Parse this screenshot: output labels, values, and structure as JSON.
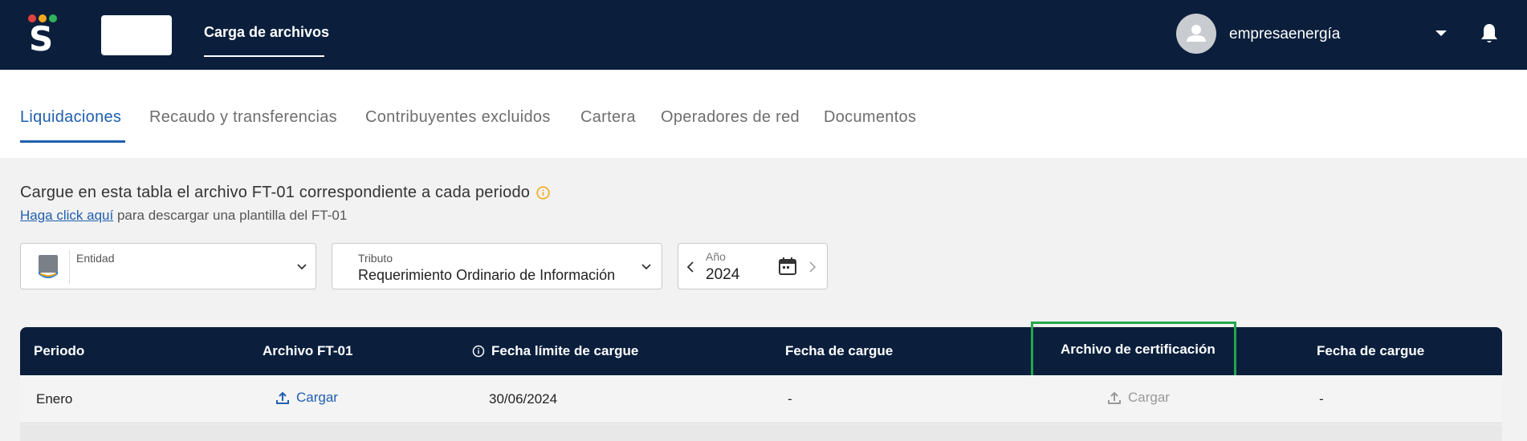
{
  "header": {
    "nav_link": "Carga de archivos",
    "username": "empresaenergía",
    "logo_colors": [
      "#e0413e",
      "#f2a91e",
      "#2fb35a"
    ]
  },
  "tabs": [
    {
      "label": "Liquidaciones",
      "active": true
    },
    {
      "label": "Recaudo y transferencias",
      "active": false
    },
    {
      "label": "Contribuyentes excluidos",
      "active": false
    },
    {
      "label": "Cartera",
      "active": false
    },
    {
      "label": "Operadores de red",
      "active": false
    },
    {
      "label": "Documentos",
      "active": false
    }
  ],
  "intro": {
    "title": "Cargue en esta tabla el archivo FT-01 correspondiente a cada periodo",
    "link": "Haga click aquí",
    "rest": " para descargar una plantilla del FT-01"
  },
  "filters": {
    "entidad": {
      "label": "Entidad"
    },
    "tributo": {
      "label": "Tributo",
      "value": "Requerimiento Ordinario de Información"
    },
    "anio": {
      "label": "Año",
      "value": "2024"
    }
  },
  "table": {
    "headers": [
      "Periodo",
      "Archivo FT-01",
      "Fecha límite de cargue",
      "Fecha de cargue",
      "Archivo de certificación",
      "Fecha de cargue"
    ],
    "rows": [
      {
        "periodo": "Enero",
        "archivo_ft01": "Cargar",
        "fecha_limite": "30/06/2024",
        "fecha_cargue": "-",
        "archivo_cert": "Cargar",
        "fecha_cargue_cert": "-"
      }
    ]
  },
  "colors": {
    "navy": "#0b1f3d",
    "accent": "#1f5fb0",
    "highlight": "#22a84a",
    "info": "#f2a91e"
  }
}
